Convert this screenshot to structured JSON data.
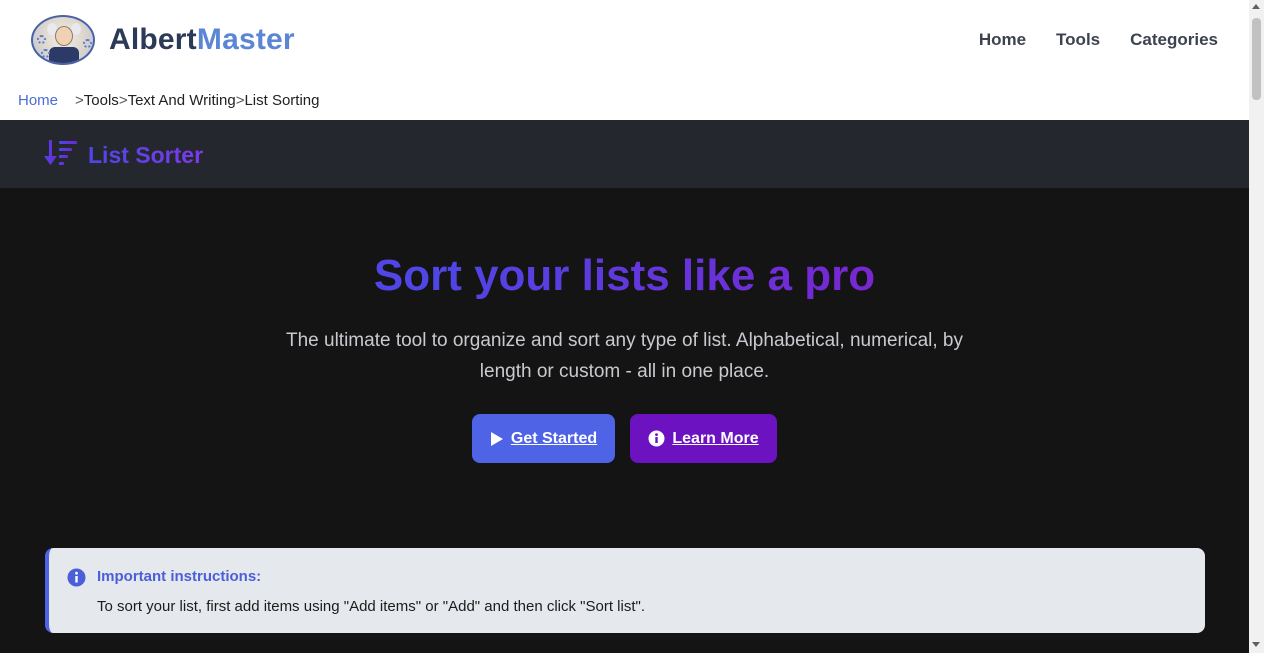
{
  "header": {
    "brand_part1": "Albert",
    "brand_part2": "Master",
    "nav": [
      {
        "label": "Home"
      },
      {
        "label": "Tools"
      },
      {
        "label": "Categories"
      }
    ]
  },
  "breadcrumb": {
    "home": "Home",
    "separator": ">",
    "items": [
      "Tools",
      "Text And Writing",
      "List Sorting"
    ]
  },
  "tool": {
    "title": "List Sorter",
    "icon": "sort-list-icon"
  },
  "hero": {
    "title": "Sort your lists like a pro",
    "subtitle": "The ultimate tool to organize and sort any type of list. Alphabetical, numerical, by length or custom - all in one place.",
    "get_started_label": "Get Started",
    "learn_more_label": "Learn More"
  },
  "notice": {
    "title": "Important instructions:",
    "text": "To sort your list, first add items using \"Add items\" or \"Add\" and then click \"Sort list\"."
  },
  "colors": {
    "accent_blue": "#4f63e6",
    "accent_purple": "#6d12c0",
    "page_bg": "#141414",
    "toolbar_bg": "#24272d"
  }
}
